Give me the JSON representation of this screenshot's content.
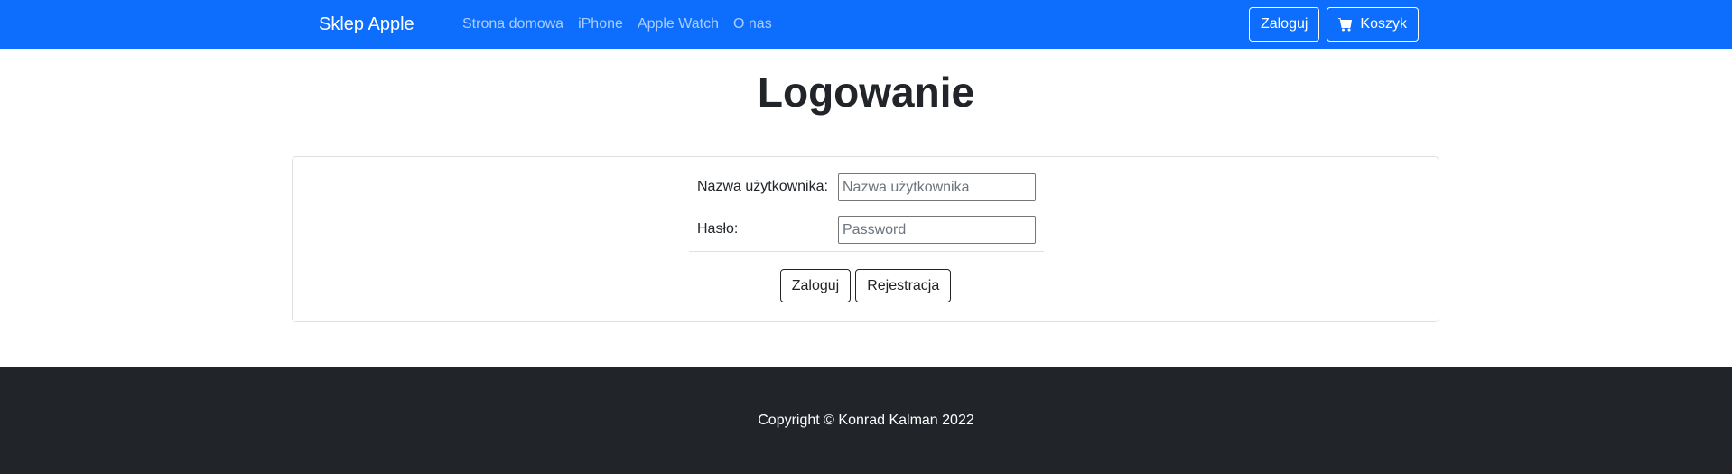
{
  "navbar": {
    "brand": "Sklep Apple",
    "links": [
      {
        "label": "Strona domowa"
      },
      {
        "label": "iPhone"
      },
      {
        "label": "Apple Watch"
      },
      {
        "label": "O nas"
      }
    ],
    "login_label": "Zaloguj",
    "cart_label": "Koszyk",
    "cart_icon": "shopping-cart-icon",
    "background_color": "#0d6efd"
  },
  "main": {
    "title": "Logowanie",
    "form": {
      "username_label": "Nazwa użytkownika:",
      "username_placeholder": "Nazwa użytkownika",
      "username_value": "",
      "password_label": "Hasło:",
      "password_placeholder": "Password",
      "password_value": "",
      "submit_label": "Zaloguj",
      "register_label": "Rejestracja"
    }
  },
  "footer": {
    "text": "Copyright © Konrad Kalman 2022",
    "background_color": "#212529"
  }
}
